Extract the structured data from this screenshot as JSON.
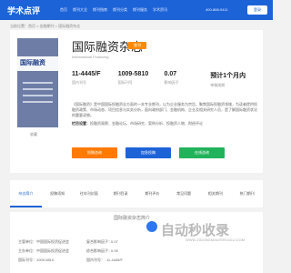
{
  "header": {
    "logo": "学术点评",
    "nav": [
      "首页",
      "期刊大全",
      "期刊指南",
      "期刊分类",
      "期刊服务",
      "学术资讯"
    ],
    "phone": "400-888-9411",
    "login": "登录"
  },
  "breadcrumb": "当前位置：首页 > 金融期刊 > 国际融资杂志",
  "cover": {
    "title": "国际融资",
    "favorite": "收藏"
  },
  "journal": {
    "title": "国际融资杂志",
    "badge": "普刊",
    "subtitle": "International Financing",
    "stats": [
      {
        "value": "11-4445/F",
        "label": "国内刊号"
      },
      {
        "value": "1009-5810",
        "label": "国际刊号"
      },
      {
        "value": "0.07",
        "label": "影响因子"
      },
      {
        "value": "预计1个月内",
        "label": "审稿周期"
      }
    ],
    "description": "《国际融资》是中国国际投融资业方面的一本专业期刊，以为企业服务为宗旨，聚焦国际投融资领域，为读者提供投融资政策、市场动态、项目信息与实务分析，面向政府部门、金融机构、企业及相关研究人员，是了解国际融资状况的重要读物。",
    "tags_label": "栏目设置：",
    "tags": "投融资观察、金融论坛、市场研究、案例分析、投融资人物、财经评论"
  },
  "buttons": {
    "submit": "投稿咨询",
    "subscribe": "加急投稿",
    "consult": "在线咨询"
  },
  "tabs": [
    "杂志简介",
    "投稿须知",
    "往年刊封面",
    "期刊目录",
    "期刊评价",
    "常见问题",
    "相关期刊",
    "热门期刊"
  ],
  "section": {
    "title": "国际融资杂志简介",
    "fields": [
      {
        "label": "主管单位：",
        "value": "中国国际投资促进会"
      },
      {
        "label": "主办单位：",
        "value": "中国国际投资促进会"
      },
      {
        "label": "国际刊号：",
        "value": "1009-5810"
      },
      {
        "label": "复合影响因子：",
        "value": "0.07"
      },
      {
        "label": "综合影响因子：",
        "value": "0.05"
      },
      {
        "label": "国内刊号：",
        "value": "11-4445/F"
      }
    ]
  },
  "watermark": {
    "text": "自动秒收录",
    "url": "WWW.ZIDONGMIAOSHOULU.COM"
  }
}
